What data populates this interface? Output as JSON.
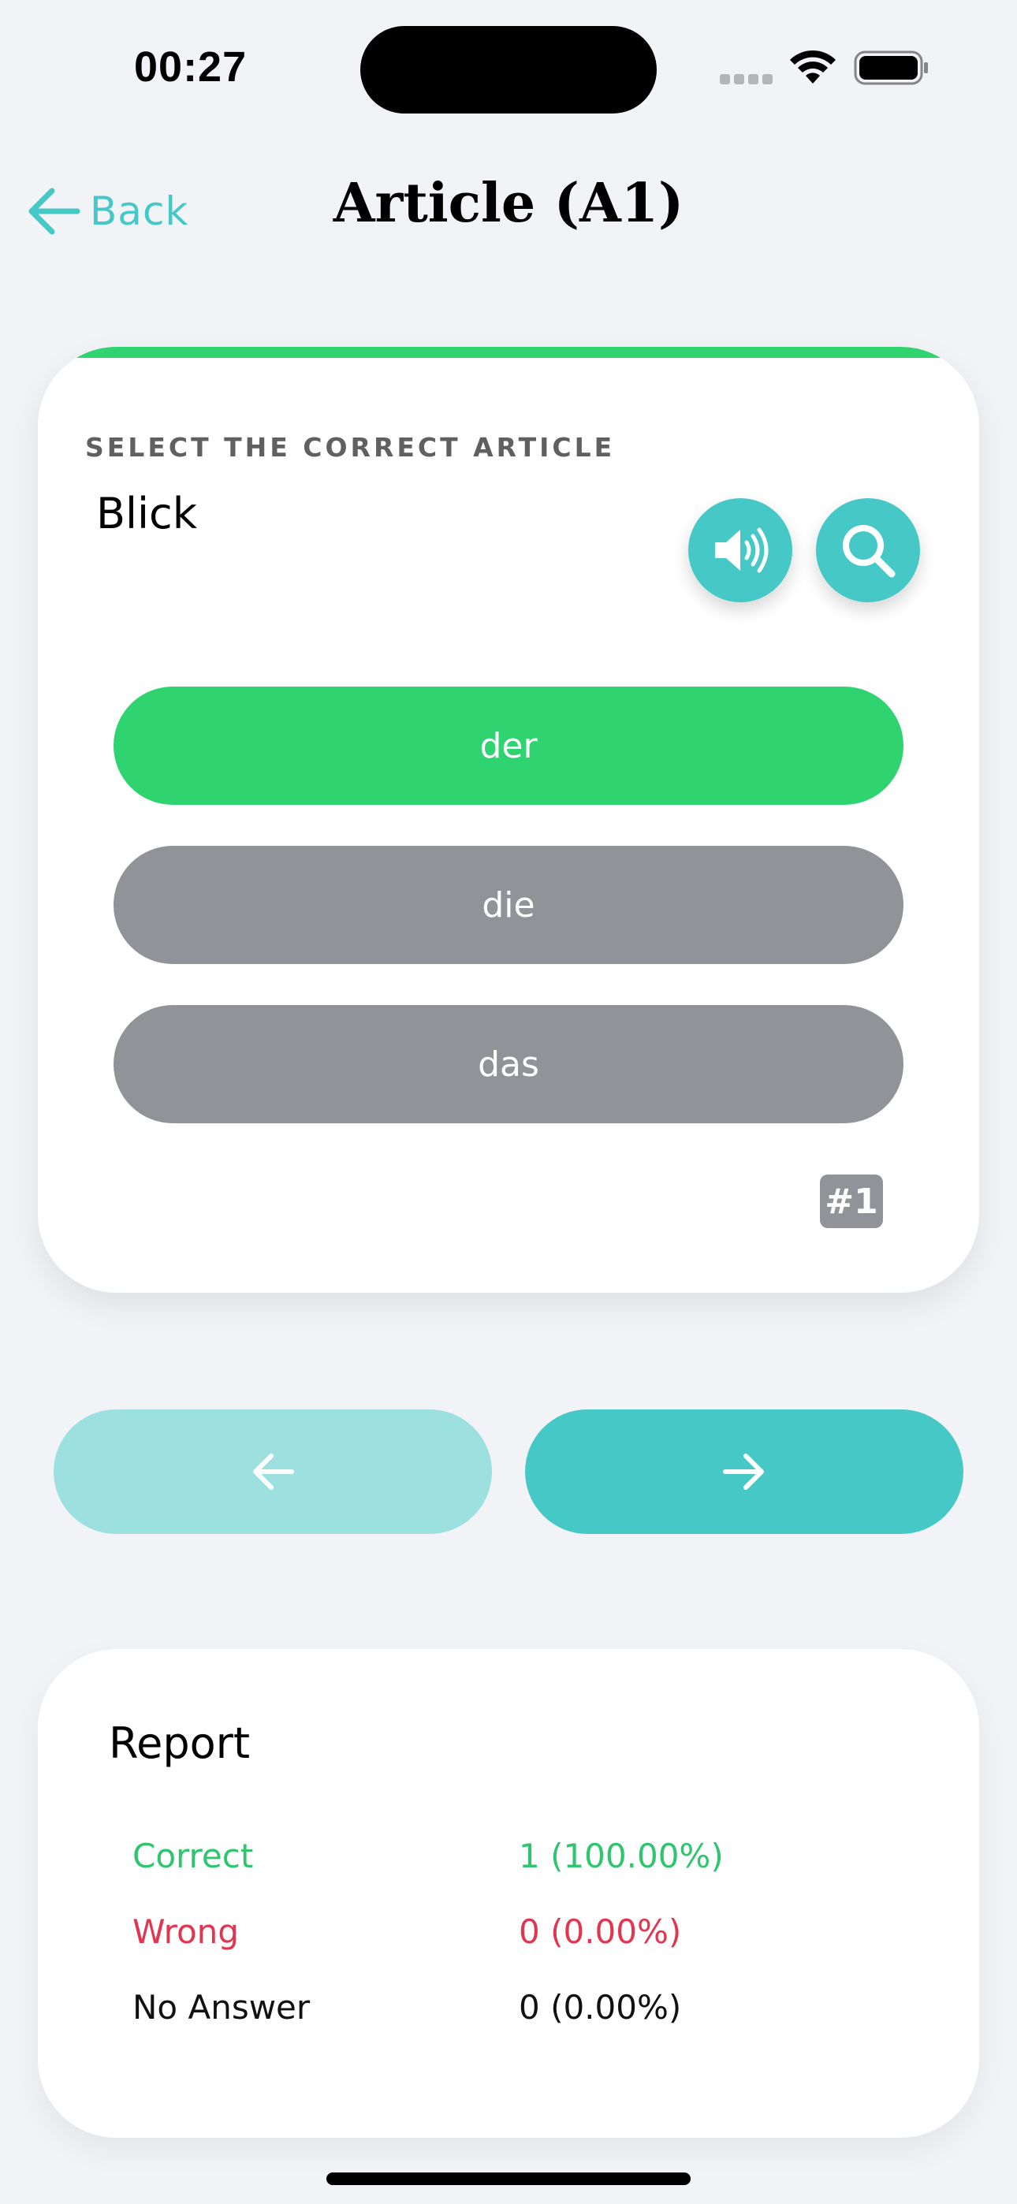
{
  "status_bar": {
    "time": "00:27"
  },
  "nav": {
    "back_label": "Back",
    "title": "Article (A1)"
  },
  "quiz": {
    "progress_fraction": 1.0,
    "instruction": "SELECT THE CORRECT ARTICLE",
    "word": "Blick",
    "answers": [
      {
        "label": "der",
        "state": "correct"
      },
      {
        "label": "die",
        "state": "neutral"
      },
      {
        "label": "das",
        "state": "neutral"
      }
    ],
    "question_number": "#1"
  },
  "navigation": {
    "prev_icon": "arrow-left-icon",
    "next_icon": "arrow-right-icon"
  },
  "report": {
    "title": "Report",
    "rows": [
      {
        "label": "Correct",
        "value": "1 (100.00%)"
      },
      {
        "label": "Wrong",
        "value": "0 (0.00%)"
      },
      {
        "label": "No Answer",
        "value": "0 (0.00%)"
      }
    ]
  },
  "colors": {
    "accent": "#45c8c6",
    "accent_light": "#9ce0e0",
    "correct": "#2fd36f",
    "wrong": "#e0364f",
    "neutral": "#919399",
    "background": "#f2f3f7"
  }
}
